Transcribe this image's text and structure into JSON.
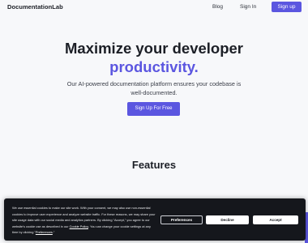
{
  "header": {
    "logo": "DocumentationLab",
    "nav": {
      "blog": "Blog",
      "sign_in": "Sign In",
      "sign_up": "Sign up"
    }
  },
  "hero": {
    "title_line1": "Maximize your developer",
    "title_line2": "productivity.",
    "subtitle": "Our AI-powered documentation platform ensures your codebase is well-documented.",
    "cta": "Sign Up For Free"
  },
  "features": {
    "title": "Features"
  },
  "cookie_banner": {
    "text_main": "We use essential cookies to make our site work. With your consent, we may also use non-essential cookies to improve user experience and analyze website traffic. For these reasons, we may share your site usage data with our social media and analytics partners. By clicking \"Accept,\" you agree to our website's cookie use as described in our ",
    "cookie_policy_link": "Cookie Policy",
    "text_mid": ". You can change your cookie settings at any time by clicking \"",
    "preferences_link": "Preferences",
    "text_end": ".\"",
    "buttons": {
      "preferences": "Preferences",
      "decline": "Decline",
      "accept": "Accept"
    }
  },
  "colors": {
    "accent": "#5b56e0",
    "background": "#f7f8fa",
    "text": "#1c1f26",
    "banner": "#15171c"
  }
}
